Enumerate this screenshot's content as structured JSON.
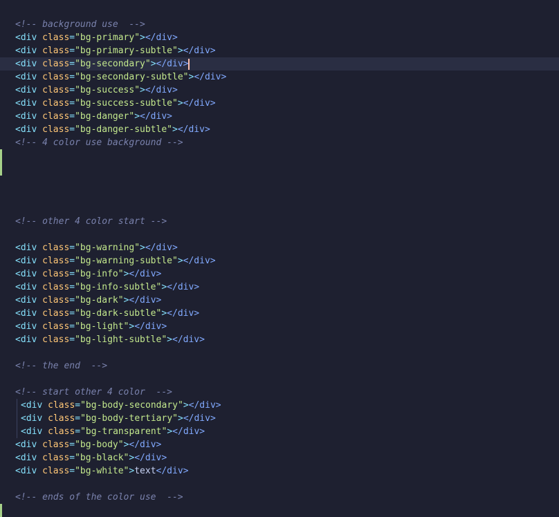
{
  "editor": {
    "current_line": 3,
    "modified_lines": [
      10,
      11,
      37
    ],
    "lines": [
      {
        "tokens": [
          [
            "comment",
            "<!-- background use  -->"
          ]
        ]
      },
      {
        "tokens": [
          [
            "tag",
            "<div "
          ],
          [
            "attr",
            "class"
          ],
          [
            "eq",
            "="
          ],
          [
            "str",
            "\"bg-primary\""
          ],
          [
            "tag",
            ">"
          ],
          [
            "close",
            "</div>"
          ]
        ]
      },
      {
        "tokens": [
          [
            "tag",
            "<div "
          ],
          [
            "attr",
            "class"
          ],
          [
            "eq",
            "="
          ],
          [
            "str",
            "\"bg-primary-subtle\""
          ],
          [
            "tag",
            ">"
          ],
          [
            "close",
            "</div>"
          ]
        ]
      },
      {
        "tokens": [
          [
            "tag",
            "<div "
          ],
          [
            "attr",
            "class"
          ],
          [
            "eq",
            "="
          ],
          [
            "str",
            "\"bg-secondary\""
          ],
          [
            "tag",
            ">"
          ],
          [
            "close",
            "</div>"
          ]
        ],
        "cursor": true
      },
      {
        "tokens": [
          [
            "tag",
            "<div "
          ],
          [
            "attr",
            "class"
          ],
          [
            "eq",
            "="
          ],
          [
            "str",
            "\"bg-secondary-subtle\""
          ],
          [
            "tag",
            ">"
          ],
          [
            "close",
            "</div>"
          ]
        ]
      },
      {
        "tokens": [
          [
            "tag",
            "<div "
          ],
          [
            "attr",
            "class"
          ],
          [
            "eq",
            "="
          ],
          [
            "str",
            "\"bg-success\""
          ],
          [
            "tag",
            ">"
          ],
          [
            "close",
            "</div>"
          ]
        ]
      },
      {
        "tokens": [
          [
            "tag",
            "<div "
          ],
          [
            "attr",
            "class"
          ],
          [
            "eq",
            "="
          ],
          [
            "str",
            "\"bg-success-subtle\""
          ],
          [
            "tag",
            ">"
          ],
          [
            "close",
            "</div>"
          ]
        ]
      },
      {
        "tokens": [
          [
            "tag",
            "<div "
          ],
          [
            "attr",
            "class"
          ],
          [
            "eq",
            "="
          ],
          [
            "str",
            "\"bg-danger\""
          ],
          [
            "tag",
            ">"
          ],
          [
            "close",
            "</div>"
          ]
        ]
      },
      {
        "tokens": [
          [
            "tag",
            "<div "
          ],
          [
            "attr",
            "class"
          ],
          [
            "eq",
            "="
          ],
          [
            "str",
            "\"bg-danger-subtle\""
          ],
          [
            "tag",
            ">"
          ],
          [
            "close",
            "</div>"
          ]
        ]
      },
      {
        "tokens": [
          [
            "comment",
            "<!-- 4 color use background -->"
          ]
        ]
      },
      {
        "tokens": []
      },
      {
        "tokens": []
      },
      {
        "tokens": []
      },
      {
        "tokens": []
      },
      {
        "tokens": []
      },
      {
        "tokens": [
          [
            "comment",
            "<!-- other 4 color start -->"
          ]
        ]
      },
      {
        "tokens": []
      },
      {
        "tokens": [
          [
            "tag",
            "<div "
          ],
          [
            "attr",
            "class"
          ],
          [
            "eq",
            "="
          ],
          [
            "str",
            "\"bg-warning\""
          ],
          [
            "tag",
            ">"
          ],
          [
            "close",
            "</div>"
          ]
        ]
      },
      {
        "tokens": [
          [
            "tag",
            "<div "
          ],
          [
            "attr",
            "class"
          ],
          [
            "eq",
            "="
          ],
          [
            "str",
            "\"bg-warning-subtle\""
          ],
          [
            "tag",
            ">"
          ],
          [
            "close",
            "</div>"
          ]
        ]
      },
      {
        "tokens": [
          [
            "tag",
            "<div "
          ],
          [
            "attr",
            "class"
          ],
          [
            "eq",
            "="
          ],
          [
            "str",
            "\"bg-info\""
          ],
          [
            "tag",
            ">"
          ],
          [
            "close",
            "</div>"
          ]
        ]
      },
      {
        "tokens": [
          [
            "tag",
            "<div "
          ],
          [
            "attr",
            "class"
          ],
          [
            "eq",
            "="
          ],
          [
            "str",
            "\"bg-info-subtle\""
          ],
          [
            "tag",
            ">"
          ],
          [
            "close",
            "</div>"
          ]
        ]
      },
      {
        "tokens": [
          [
            "tag",
            "<div "
          ],
          [
            "attr",
            "class"
          ],
          [
            "eq",
            "="
          ],
          [
            "str",
            "\"bg-dark\""
          ],
          [
            "tag",
            ">"
          ],
          [
            "close",
            "</div>"
          ]
        ]
      },
      {
        "tokens": [
          [
            "tag",
            "<div "
          ],
          [
            "attr",
            "class"
          ],
          [
            "eq",
            "="
          ],
          [
            "str",
            "\"bg-dark-subtle\""
          ],
          [
            "tag",
            ">"
          ],
          [
            "close",
            "</div>"
          ]
        ]
      },
      {
        "tokens": [
          [
            "tag",
            "<div "
          ],
          [
            "attr",
            "class"
          ],
          [
            "eq",
            "="
          ],
          [
            "str",
            "\"bg-light\""
          ],
          [
            "tag",
            ">"
          ],
          [
            "close",
            "</div>"
          ]
        ]
      },
      {
        "tokens": [
          [
            "tag",
            "<div "
          ],
          [
            "attr",
            "class"
          ],
          [
            "eq",
            "="
          ],
          [
            "str",
            "\"bg-light-subtle\""
          ],
          [
            "tag",
            ">"
          ],
          [
            "close",
            "</div>"
          ]
        ]
      },
      {
        "tokens": []
      },
      {
        "tokens": [
          [
            "comment",
            "<!-- the end  -->"
          ]
        ]
      },
      {
        "tokens": []
      },
      {
        "tokens": [
          [
            "comment",
            "<!-- start other 4 color  -->"
          ]
        ]
      },
      {
        "tokens": [
          [
            "tag",
            "<div "
          ],
          [
            "attr",
            "class"
          ],
          [
            "eq",
            "="
          ],
          [
            "str",
            "\"bg-body-secondary\""
          ],
          [
            "tag",
            ">"
          ],
          [
            "close",
            "</div>"
          ]
        ],
        "indent": true
      },
      {
        "tokens": [
          [
            "tag",
            "<div "
          ],
          [
            "attr",
            "class"
          ],
          [
            "eq",
            "="
          ],
          [
            "str",
            "\"bg-body-tertiary\""
          ],
          [
            "tag",
            ">"
          ],
          [
            "close",
            "</div>"
          ]
        ],
        "indent": true
      },
      {
        "tokens": [
          [
            "tag",
            "<div "
          ],
          [
            "attr",
            "class"
          ],
          [
            "eq",
            "="
          ],
          [
            "str",
            "\"bg-transparent\""
          ],
          [
            "tag",
            ">"
          ],
          [
            "close",
            "</div>"
          ]
        ],
        "indent": true
      },
      {
        "tokens": [
          [
            "tag",
            "<div "
          ],
          [
            "attr",
            "class"
          ],
          [
            "eq",
            "="
          ],
          [
            "str",
            "\"bg-body\""
          ],
          [
            "tag",
            ">"
          ],
          [
            "close",
            "</div>"
          ]
        ]
      },
      {
        "tokens": [
          [
            "tag",
            "<div "
          ],
          [
            "attr",
            "class"
          ],
          [
            "eq",
            "="
          ],
          [
            "str",
            "\"bg-black\""
          ],
          [
            "tag",
            ">"
          ],
          [
            "close",
            "</div>"
          ]
        ]
      },
      {
        "tokens": [
          [
            "tag",
            "<div "
          ],
          [
            "attr",
            "class"
          ],
          [
            "eq",
            "="
          ],
          [
            "str",
            "\"bg-white\""
          ],
          [
            "tag",
            ">"
          ],
          [
            "text",
            "text"
          ],
          [
            "close",
            "</div>"
          ]
        ]
      },
      {
        "tokens": []
      },
      {
        "tokens": [
          [
            "comment",
            "<!-- ends of the color use  -->"
          ]
        ]
      },
      {
        "tokens": []
      }
    ]
  }
}
